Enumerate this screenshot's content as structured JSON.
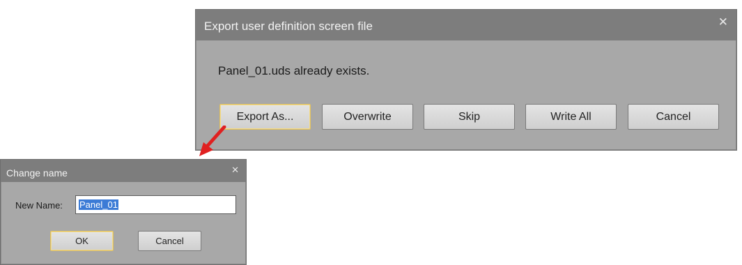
{
  "export_dialog": {
    "title": "Export user definition screen file",
    "close_glyph": "✕",
    "message": "Panel_01.uds already exists.",
    "buttons": {
      "export_as": "Export As...",
      "overwrite": "Overwrite",
      "skip": "Skip",
      "write_all": "Write All",
      "cancel": "Cancel"
    }
  },
  "change_name_dialog": {
    "title": "Change name",
    "close_glyph": "✕",
    "new_name_label": "New Name:",
    "new_name_value": "Panel_01",
    "buttons": {
      "ok": "OK",
      "cancel": "Cancel"
    }
  },
  "colors": {
    "dialog_body": "#a8a8a8",
    "title_bar": "#7d7d7d",
    "default_button_border": "#e0c060",
    "arrow": "#e02020",
    "selection": "#3b7bd6"
  }
}
